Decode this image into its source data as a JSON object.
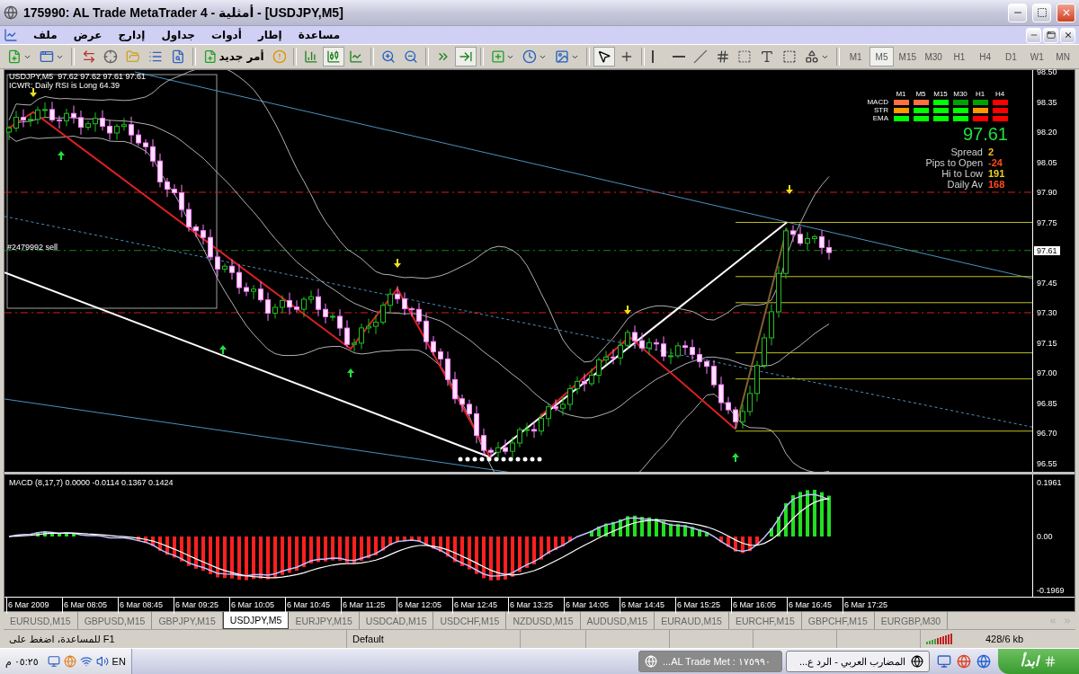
{
  "window": {
    "title": "175990: AL Trade MetaTrader 4 - أمثلية - [USDJPY,M5]"
  },
  "menu": [
    "مساعدة",
    "إطار",
    "أدوات",
    "جداول",
    "إدارج",
    "عرض",
    "ملف"
  ],
  "toolbar": {
    "tools": [
      {
        "kind": "new-chart",
        "pressed": false
      },
      {
        "kind": "profiles",
        "pressed": false
      },
      {
        "kind": "sep"
      },
      {
        "kind": "market-watch",
        "pressed": false
      },
      {
        "kind": "data-window",
        "pressed": false
      },
      {
        "kind": "navigator",
        "pressed": false
      },
      {
        "kind": "terminal",
        "pressed": false
      },
      {
        "kind": "tester",
        "pressed": false
      },
      {
        "kind": "sep"
      },
      {
        "kind": "new-order",
        "label": "أمر جديد",
        "pressed": false
      },
      {
        "kind": "alert",
        "pressed": false
      },
      {
        "kind": "sep"
      },
      {
        "kind": "bar-chart",
        "pressed": false
      },
      {
        "kind": "candles",
        "pressed": true
      },
      {
        "kind": "line-chart",
        "pressed": false
      },
      {
        "kind": "sep"
      },
      {
        "kind": "zoom-in",
        "pressed": false
      },
      {
        "kind": "zoom-out",
        "pressed": false
      },
      {
        "kind": "sep"
      },
      {
        "kind": "autoscroll",
        "pressed": false
      },
      {
        "kind": "chart-shift",
        "pressed": true
      },
      {
        "kind": "sep"
      },
      {
        "kind": "indicators",
        "pressed": false
      },
      {
        "kind": "periods",
        "pressed": false
      },
      {
        "kind": "templates",
        "pressed": false
      },
      {
        "kind": "sep"
      },
      {
        "kind": "cursor",
        "pressed": true
      },
      {
        "kind": "crosshair",
        "pressed": false
      },
      {
        "kind": "sep"
      },
      {
        "kind": "vline",
        "pressed": false
      },
      {
        "kind": "hline",
        "pressed": false
      },
      {
        "kind": "trendline",
        "pressed": false
      },
      {
        "kind": "channel",
        "pressed": false
      },
      {
        "kind": "fibo",
        "pressed": false
      },
      {
        "kind": "text",
        "pressed": false
      },
      {
        "kind": "label",
        "pressed": false
      },
      {
        "kind": "shapes",
        "pressed": false
      },
      {
        "kind": "sep"
      }
    ],
    "timeframes": [
      {
        "label": "M1",
        "selected": false
      },
      {
        "label": "M5",
        "selected": true
      },
      {
        "label": "M15",
        "selected": false
      },
      {
        "label": "M30",
        "selected": false
      },
      {
        "label": "H1",
        "selected": false
      },
      {
        "label": "H4",
        "selected": false
      },
      {
        "label": "D1",
        "selected": false
      },
      {
        "label": "W1",
        "selected": false
      },
      {
        "label": "MN",
        "selected": false
      }
    ]
  },
  "chart": {
    "header": "USDJPY,M5  97.62 97.62 97.61 97.61",
    "indicator_note": "ICWR: Daily RSI is Long 64.39",
    "order_label": "#2479992 sell",
    "signal_panel": {
      "columns": [
        "M1",
        "M5",
        "M15",
        "M30",
        "H1",
        "H4"
      ],
      "rows": [
        {
          "label": "MACD",
          "cells": [
            {
              "color": "#ff7040"
            },
            {
              "color": "#ff7040"
            },
            {
              "color": "#00ff00"
            },
            {
              "color": "#00a000"
            },
            {
              "color": "#00a000"
            },
            {
              "color": "#ff0000"
            }
          ]
        },
        {
          "label": "STR",
          "cells": [
            {
              "color": "#ff9900"
            },
            {
              "color": "#00ff00"
            },
            {
              "color": "#00ff00"
            },
            {
              "color": "#00ff00"
            },
            {
              "color": "#ff9900"
            },
            {
              "color": "#ff0000"
            }
          ]
        },
        {
          "label": "EMA",
          "cells": [
            {
              "color": "#00ff00"
            },
            {
              "color": "#00ff00"
            },
            {
              "color": "#00ff00"
            },
            {
              "color": "#00ff00"
            },
            {
              "color": "#ff0000"
            },
            {
              "color": "#ff0000"
            }
          ]
        }
      ]
    },
    "price": "97.61",
    "stats": [
      {
        "label": "Spread",
        "value": "2",
        "color": "#f0c020"
      },
      {
        "label": "Pips to Open",
        "value": "-24",
        "color": "#ff4a1a"
      },
      {
        "label": "Hi to Low",
        "value": "191",
        "color": "#f0d020"
      },
      {
        "label": "Daily Av",
        "value": "168",
        "color": "#ff4a1a"
      }
    ],
    "price_axis": [
      "98.50",
      "98.35",
      "98.20",
      "98.05",
      "97.90",
      "97.75",
      "97.45",
      "97.30",
      "97.15",
      "97.00",
      "96.85",
      "96.70",
      "96.55"
    ],
    "current_price_tag": "97.61",
    "time_axis": [
      "6 Mar 2009",
      "6 Mar 08:05",
      "6 Mar 08:45",
      "6 Mar 09:25",
      "6 Mar 10:05",
      "6 Mar 10:45",
      "6 Mar 11:25",
      "6 Mar 12:05",
      "6 Mar 12:45",
      "6 Mar 13:25",
      "6 Mar 14:05",
      "6 Mar 14:45",
      "6 Mar 15:25",
      "6 Mar 16:05",
      "6 Mar 16:45",
      "6 Mar 17:25"
    ]
  },
  "macd": {
    "label": "MACD (8,17,7) 0.0000 -0.0114 0.1367 0.1424",
    "axis": [
      "0.1961",
      "0.00",
      "-0.1969"
    ]
  },
  "tabs": [
    {
      "label": "EURUSD,M15",
      "selected": false
    },
    {
      "label": "GBPUSD,M15",
      "selected": false
    },
    {
      "label": "GBPJPY,M15",
      "selected": false
    },
    {
      "label": "USDJPY,M5",
      "selected": true
    },
    {
      "label": "EURJPY,M15",
      "selected": false
    },
    {
      "label": "USDCAD,M15",
      "selected": false
    },
    {
      "label": "USDCHF,M15",
      "selected": false
    },
    {
      "label": "NZDUSD,M15",
      "selected": false
    },
    {
      "label": "AUDUSD,M15",
      "selected": false
    },
    {
      "label": "EURAUD,M15",
      "selected": false
    },
    {
      "label": "EURCHF,M15",
      "selected": false
    },
    {
      "label": "GBPCHF,M15",
      "selected": false
    },
    {
      "label": "EURGBP,M30",
      "selected": false
    }
  ],
  "status_bar": {
    "hint": "للمساعدة، اضغط على F1",
    "profile": "Default",
    "traffic": "428/6 kb"
  },
  "taskbar": {
    "start": "ابدأ",
    "tasks": [
      {
        "label": "...AL Trade Met : ١٧٥٩٩٠",
        "selected": true
      },
      {
        "label": "المضارب العربي - الرد ع...",
        "selected": false
      }
    ],
    "language": "EN",
    "clock": "٠٥:٢٥ م"
  }
}
